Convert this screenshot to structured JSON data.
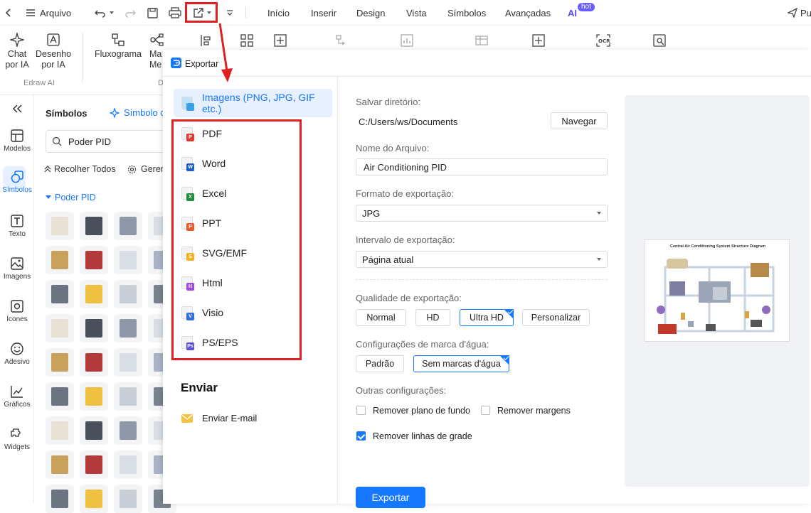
{
  "topbar": {
    "file_label": "Arquivo",
    "tabs": [
      "Início",
      "Inserir",
      "Design",
      "Vista",
      "Símbolos",
      "Avançadas",
      "AI"
    ],
    "hot_badge": "hot",
    "publish_label": "Pu"
  },
  "ribbon": {
    "chat_ia": "Chat por IA",
    "desenho_ia": "Desenho por IA",
    "fluxograma": "Fluxograma",
    "mapa": "Ma Me",
    "group_label": "Edraw AI",
    "group_label_2": "D"
  },
  "leftnav": {
    "items": [
      {
        "label": "Modelos",
        "icon": "template-icon"
      },
      {
        "label": "Símbolos",
        "icon": "symbols-icon"
      },
      {
        "label": "Texto",
        "icon": "text-icon"
      },
      {
        "label": "Imagens",
        "icon": "image-icon"
      },
      {
        "label": "Ícones",
        "icon": "icons-icon"
      },
      {
        "label": "Adesivo",
        "icon": "sticker-icon"
      },
      {
        "label": "Gráficos",
        "icon": "chart-icon"
      },
      {
        "label": "Widgets",
        "icon": "widgets-icon"
      }
    ]
  },
  "symbols_panel": {
    "title": "Símbolos",
    "ai_symbol": "Símbolo d",
    "search_value": "Poder PID",
    "collapse_all": "Recolher Todos",
    "manage": "Geren",
    "category": "Poder PID"
  },
  "dialog": {
    "title": "Exportar",
    "formats": [
      {
        "label": "Imagens (PNG, JPG, GIF etc.)",
        "color": "#3aa0e8",
        "badge": "",
        "selected": true
      },
      {
        "label": "PDF",
        "color": "#e53935",
        "badge": "P"
      },
      {
        "label": "Word",
        "color": "#1e5bc6",
        "badge": "W"
      },
      {
        "label": "Excel",
        "color": "#1e8e3e",
        "badge": "X"
      },
      {
        "label": "PPT",
        "color": "#e8582a",
        "badge": "P"
      },
      {
        "label": "SVG/EMF",
        "color": "#f2b01e",
        "badge": "S"
      },
      {
        "label": "Html",
        "color": "#a24bd6",
        "badge": "H"
      },
      {
        "label": "Visio",
        "color": "#2f6fe0",
        "badge": "V"
      },
      {
        "label": "PS/EPS",
        "color": "#5b4fd6",
        "badge": "Ps"
      }
    ],
    "send_heading": "Enviar",
    "send_email": "Enviar E-mail",
    "save_dir_label": "Salvar diretório:",
    "save_dir_value": "C:/Users/ws/Documents",
    "browse": "Navegar",
    "filename_label": "Nome do Arquivo:",
    "filename_value": "Air Conditioning PID",
    "format_label": "Formato de exportação:",
    "format_value": "JPG",
    "range_label": "Intervalo de exportação:",
    "range_value": "Página atual",
    "quality_label": "Qualidade de exportação:",
    "quality_options": [
      "Normal",
      "HD",
      "Ultra HD",
      "Personalizar"
    ],
    "quality_selected": "Ultra HD",
    "watermark_label": "Configurações de marca d'água:",
    "watermark_options": [
      "Padrão",
      "Sem marcas d'água"
    ],
    "watermark_selected": "Sem marcas d'água",
    "other_label": "Outras configurações:",
    "remove_background": "Remover plano de fundo",
    "remove_margins": "Remover margens",
    "remove_grid": "Remover linhas de grade",
    "remove_background_checked": false,
    "remove_margins_checked": false,
    "remove_grid_checked": true,
    "export_button": "Exportar",
    "preview_title": "Central Air Conditioning System Structure Diagram"
  },
  "colors": {
    "accent": "#1677ff",
    "highlight_red": "#e02020"
  }
}
